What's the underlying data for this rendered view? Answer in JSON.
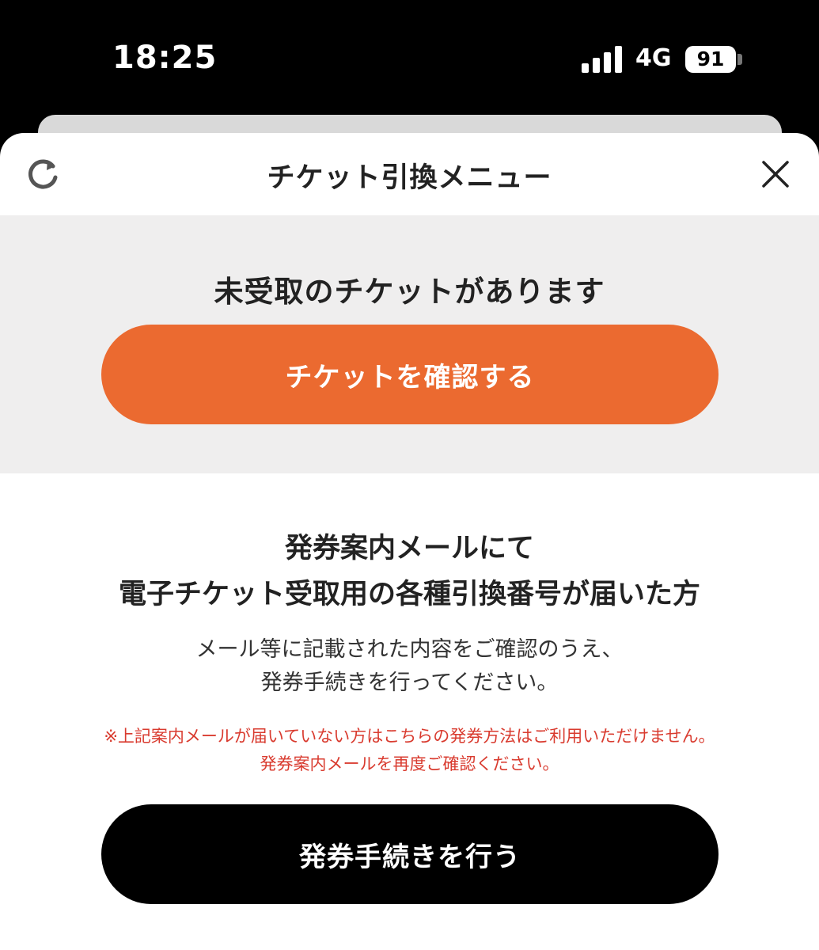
{
  "status_bar": {
    "time": "18:25",
    "network": "4G",
    "battery": "91"
  },
  "header": {
    "title": "チケット引換メニュー",
    "refresh_icon": "refresh-icon",
    "close_icon": "close-icon"
  },
  "unreceived": {
    "message": "未受取のチケットがあります",
    "button_label": "チケットを確認する"
  },
  "issuance": {
    "heading_line1": "発券案内メールにて",
    "heading_line2": "電子チケット受取用の各種引換番号が届いた方",
    "description_line1": "メール等に記載された内容をご確認のうえ、",
    "description_line2": "発券手続きを行ってください。",
    "note_line1": "※上記案内メールが届いていない方はこちらの発券方法はご利用いただけません。",
    "note_line2": "発券案内メールを再度ご確認ください。",
    "button_label": "発券手続きを行う"
  },
  "colors": {
    "accent_orange": "#eb6a30",
    "note_red": "#d93b2f",
    "gray_section": "#efeeee"
  }
}
